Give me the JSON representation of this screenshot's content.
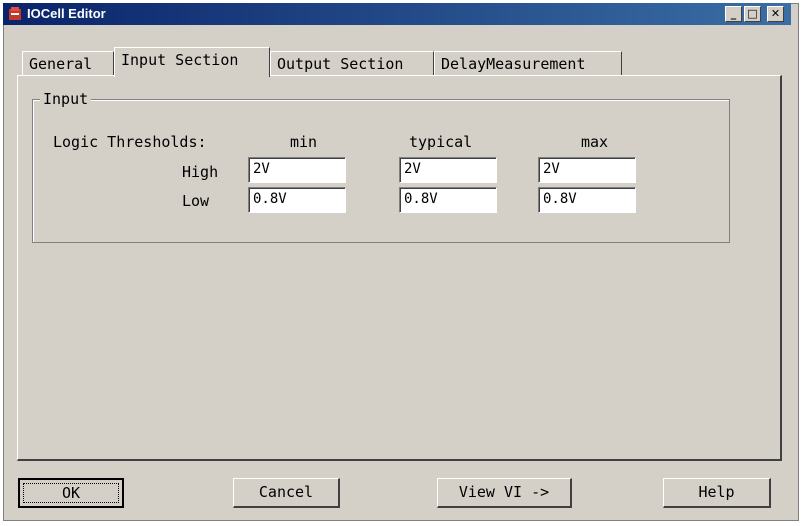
{
  "window": {
    "title": "IOCell Editor",
    "controls": {
      "minimize": "_",
      "maximize": "□",
      "close": "✕"
    }
  },
  "tabs": [
    {
      "label": "General"
    },
    {
      "label": "Input Section"
    },
    {
      "label": "Output Section"
    },
    {
      "label": "DelayMeasurement"
    }
  ],
  "input_group": {
    "legend": "Input",
    "row_header": "Logic Thresholds:",
    "columns": [
      "min",
      "typical",
      "max"
    ],
    "rows": [
      {
        "label": "High",
        "values": [
          "2V",
          "2V",
          "2V"
        ]
      },
      {
        "label": "Low",
        "values": [
          "0.8V",
          "0.8V",
          "0.8V"
        ]
      }
    ]
  },
  "buttons": {
    "ok": "OK",
    "cancel": "Cancel",
    "view_vi": "View VI ->",
    "help": "Help"
  },
  "colors": {
    "titlebar": "#0a246a",
    "face": "#d4d0c8"
  }
}
